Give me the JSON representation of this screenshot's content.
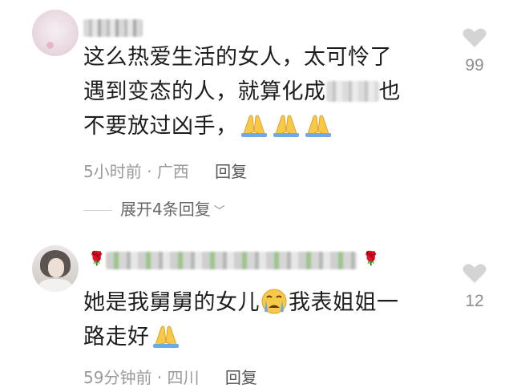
{
  "comments": [
    {
      "text_lines": [
        "这么热爱生活的女人，太可怜了",
        "遇到变态的人，就算化成",
        "也",
        "不要放过凶手，"
      ],
      "time": "5小时前",
      "location": "广西",
      "separator": "·",
      "reply_label": "回复",
      "likes": "99",
      "expand_label": "展开4条回复",
      "emoji": "pray-emoji"
    },
    {
      "text_line1_a": "她是我舅舅的女儿",
      "text_line1_b": "我表姐姐一",
      "text_line2": "路走好",
      "time": "59分钟前",
      "location": "四川",
      "separator": "·",
      "reply_label": "回复",
      "likes": "12",
      "emojis": [
        "crying-face-emoji",
        "pray-emoji"
      ]
    }
  ],
  "colors": {
    "text": "#1d1d1d",
    "meta": "#9a9a9a",
    "heart": "#d4d4d4"
  }
}
